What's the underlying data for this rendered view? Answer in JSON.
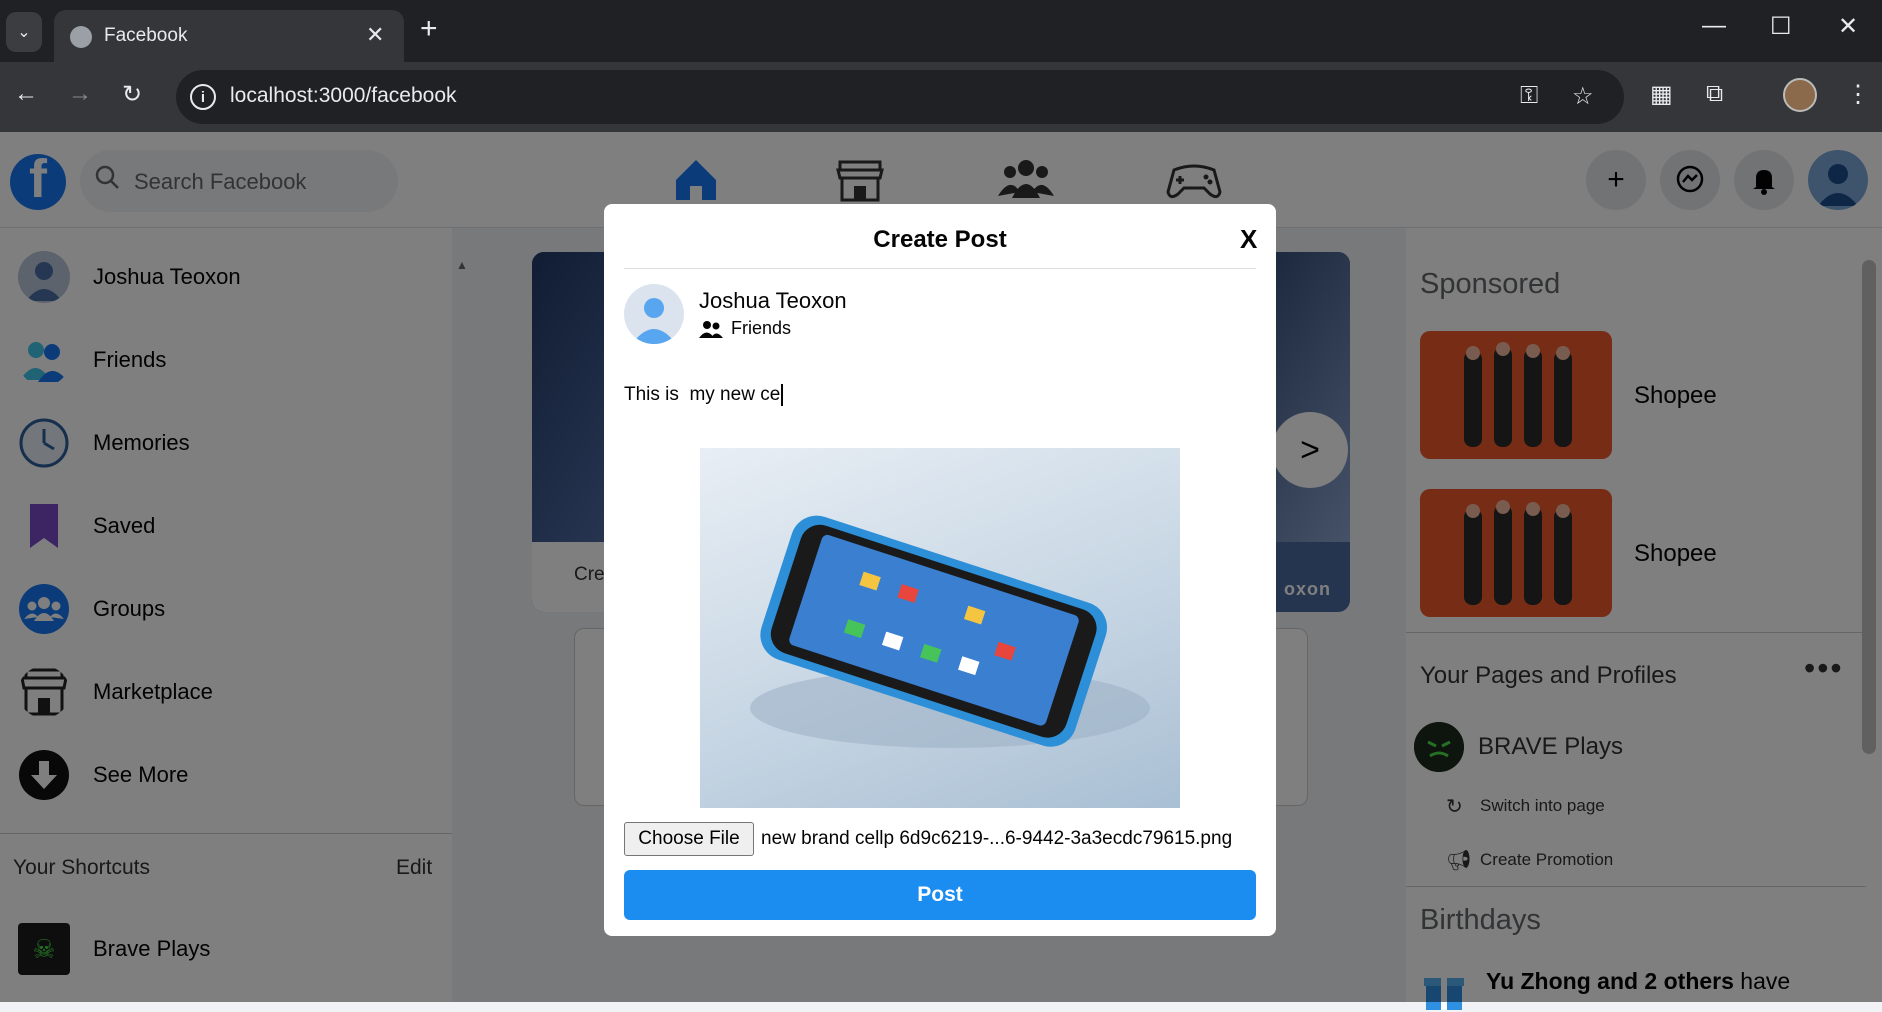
{
  "browser": {
    "tab_title": "Facebook",
    "url": "localhost:3000/facebook"
  },
  "header": {
    "search_placeholder": "Search Facebook"
  },
  "sidebar": {
    "items": [
      {
        "label": "Joshua Teoxon",
        "icon": "profile-avatar"
      },
      {
        "label": "Friends",
        "icon": "friends-icon"
      },
      {
        "label": "Memories",
        "icon": "clock-icon"
      },
      {
        "label": "Saved",
        "icon": "bookmark-icon"
      },
      {
        "label": "Groups",
        "icon": "groups-icon"
      },
      {
        "label": "Marketplace",
        "icon": "store-icon"
      },
      {
        "label": "See More",
        "icon": "arrow-down-icon"
      }
    ],
    "shortcuts_title": "Your Shortcuts",
    "shortcuts_edit": "Edit",
    "shortcut_item": "Brave Plays"
  },
  "feed": {
    "story_partial_left": "Cre",
    "story_partial_right": "oxon",
    "story_next": ">"
  },
  "right": {
    "sponsored_title": "Sponsored",
    "ads": [
      {
        "name": "Shopee"
      },
      {
        "name": "Shopee"
      }
    ],
    "pages_title": "Your Pages and Profiles",
    "more": "•••",
    "page_name": "BRAVE Plays",
    "switch_label": "Switch into page",
    "promo_label": "Create Promotion",
    "birthdays_title": "Birthdays",
    "birthday_bold": "Yu Zhong and 2 others",
    "birthday_rest": " have"
  },
  "modal": {
    "title": "Create Post",
    "close": "X",
    "author": "Joshua Teoxon",
    "audience": "Friends",
    "text": "This is  my new ce",
    "choose_file": "Choose File",
    "file_name": "new brand cellp 6d9c6219-...6-9442-3a3ecdc79615.png",
    "post_button": "Post"
  },
  "colors": {
    "facebook_blue": "#1877f2",
    "post_button": "#1b8cf0"
  }
}
